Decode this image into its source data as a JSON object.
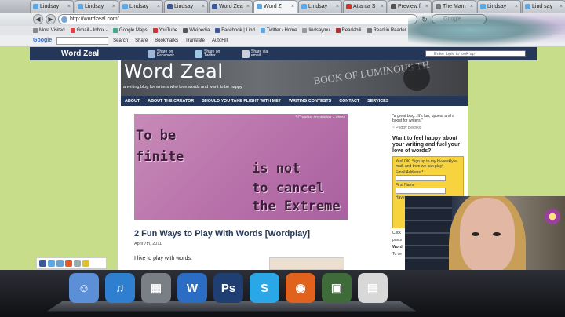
{
  "browser": {
    "tabs": [
      {
        "label": "Lindsay",
        "color": "#5aa9e6"
      },
      {
        "label": "Lindsay",
        "color": "#5aa9e6"
      },
      {
        "label": "Lindsay",
        "color": "#5aa9e6"
      },
      {
        "label": "Lindsay",
        "color": "#3b5998"
      },
      {
        "label": "Word Zea",
        "color": "#3b5998"
      },
      {
        "label": "Word Z",
        "color": "#5aa9e6",
        "active": true
      },
      {
        "label": "Lindsay",
        "color": "#5aa9e6"
      },
      {
        "label": "Atlanta S",
        "color": "#cc3333"
      },
      {
        "label": "Preview f",
        "color": "#555"
      },
      {
        "label": "The Mam",
        "color": "#777"
      },
      {
        "label": "Lindsay",
        "color": "#5aa9e6"
      },
      {
        "label": "Lind say",
        "color": "#5aa9e6"
      }
    ],
    "url": "http://wordzeal.com/",
    "search_placeholder": "Google",
    "back_label": "◀",
    "forward_label": "▶",
    "reload_label": "↻",
    "bookmarks": [
      {
        "label": "Most Visited",
        "color": "#888"
      },
      {
        "label": "Gmail - Inbox -",
        "color": "#d44"
      },
      {
        "label": "Google Maps",
        "color": "#4a8"
      },
      {
        "label": "YouTube",
        "color": "#c33"
      },
      {
        "label": "Wikipedia",
        "color": "#555"
      },
      {
        "label": "Facebook | Lind",
        "color": "#3b5998"
      },
      {
        "label": "Twitter / Home",
        "color": "#5aa9e6"
      },
      {
        "label": "lindsaymu",
        "color": "#999"
      },
      {
        "label": "Readabili",
        "color": "#a33"
      },
      {
        "label": "Read in Reader",
        "color": "#777"
      }
    ],
    "google_toolbar": {
      "logo": "Google",
      "items": [
        "Search",
        "Share",
        "Bookmarks",
        "Translate",
        "AutoFill"
      ]
    }
  },
  "site": {
    "brand": "Word Zeal",
    "share": [
      {
        "label": "Share on Facebook",
        "color": "#9db7d9"
      },
      {
        "label": "Share on Twitter",
        "color": "#9fc6e3"
      },
      {
        "label": "Share via email",
        "color": "#c9d0dc"
      }
    ],
    "topic_placeholder": "Enter topic to look up",
    "banner_title": "Word Zeal",
    "banner_tagline": "a writing blog for writers who love words and want to be happy",
    "banner_watermark": "BOOK OF LUMINOUS TH",
    "nav": [
      "ABOUT",
      "ABOUT THE CREATOR",
      "SHOULD YOU TAKE FLIGHT WITH ME?",
      "WRITING CONTESTS",
      "CONTACT",
      "SERVICES"
    ],
    "hero": {
      "caption": "* Creative inspiration + video",
      "lines": [
        "To be",
        "finite",
        "is not",
        "to cancel",
        "the Extreme"
      ]
    },
    "post": {
      "title": "2 Fun Ways to Play With Words [Wordplay]",
      "date": "April 7th, 2011",
      "body": "I like to play with words."
    },
    "sidebar": {
      "quote": "\"a great blog...It's fun, upbeat and a boost for writers.\"",
      "quote_by": "~ Peggy Bechko",
      "heading": "Want to feel happy about your writing and fuel your love of words?",
      "signup_text": "Yes! OK. Sign up to my bi-weekly e-mail, and then we can play!",
      "email_label": "Email Address *",
      "first_name_label": "First Name",
      "have_label": "Have",
      "more": "Click",
      "more2": "posts",
      "more3": "Word",
      "more4": "To ce"
    },
    "left_social_colors": [
      "#3b5998",
      "#5aa9e6",
      "#66a3d2",
      "#e05a2b",
      "#9aa",
      "#e0c02b"
    ]
  },
  "dock": [
    {
      "name": "finder-icon",
      "label": "☺",
      "color": "#5b8fd8"
    },
    {
      "name": "itunes-icon",
      "label": "♫",
      "color": "#2f7fd0"
    },
    {
      "name": "dashboard-icon",
      "label": "▦",
      "color": "#7a7f86"
    },
    {
      "name": "word-icon",
      "label": "W",
      "color": "#2b6cc4"
    },
    {
      "name": "photoshop-icon",
      "label": "Ps",
      "color": "#1f3f73"
    },
    {
      "name": "skype-icon",
      "label": "S",
      "color": "#2aa7e6"
    },
    {
      "name": "firefox-icon",
      "label": "◉",
      "color": "#e0621d"
    },
    {
      "name": "photo-booth-icon",
      "label": "▣",
      "color": "#3f6b3a"
    },
    {
      "name": "preview-icon",
      "label": "▤",
      "color": "#d8d8d8"
    }
  ]
}
